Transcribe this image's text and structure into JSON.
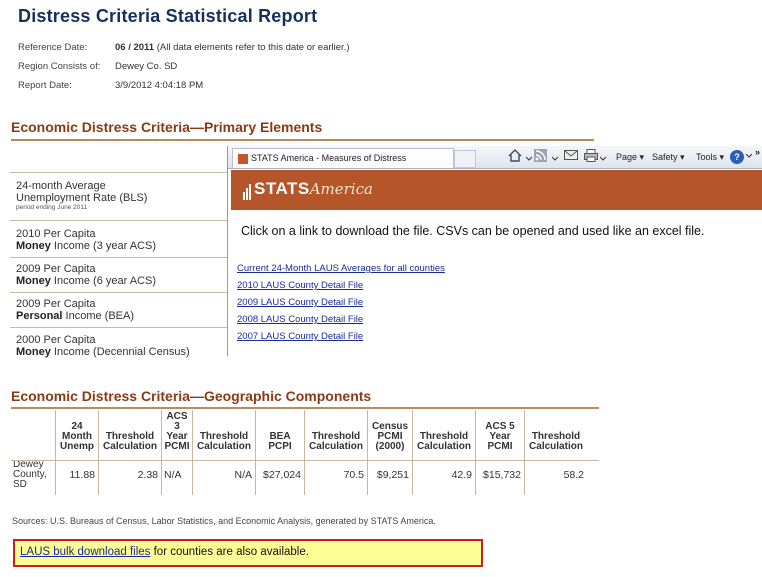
{
  "report": {
    "title": "Distress Criteria Statistical Report",
    "meta": [
      {
        "label": "Reference Date:",
        "value_bold": "06 / 2011",
        "value_rest": " (All data elements refer to this date or earlier.)"
      },
      {
        "label": "Region Consists of:",
        "value_bold": "",
        "value_rest": "Dewey Co. SD"
      },
      {
        "label": "Report Date:",
        "value_bold": "",
        "value_rest": "3/9/2012 4:04:18 PM"
      }
    ]
  },
  "primary": {
    "heading": "Economic Distress Criteria—Primary Elements",
    "items": [
      {
        "line1": "24-month Average",
        "line2": "Unemployment Rate (BLS)",
        "bold": "",
        "sub": "period ending June 2011"
      },
      {
        "line1": "2010 Per Capita",
        "bold": "Money",
        "line2": " Income (3 year ACS)",
        "sub": ""
      },
      {
        "line1": "2009 Per Capita",
        "bold": "Money",
        "line2": " Income (6 year ACS)",
        "sub": ""
      },
      {
        "line1": "2009 Per Capita",
        "bold": "Personal",
        "line2": " Income (BEA)",
        "sub": ""
      },
      {
        "line1": "2000 Per Capita",
        "bold": "Money",
        "line2": " Income (Decennial Census)",
        "sub": ""
      }
    ]
  },
  "browser": {
    "tab_title": "STATS America - Measures of Distress",
    "toolbar": {
      "page": "Page ▾",
      "safety": "Safety ▾",
      "tools": "Tools ▾",
      "help": "?",
      "chevrons": "»"
    },
    "logo_main": "STATS",
    "logo_script": "America",
    "instruction": "Click on a link to download the file. CSVs can be opened and used like an excel file.",
    "links": [
      "Current 24-Month LAUS Averages for all counties",
      "2010 LAUS County Detail File",
      "2009 LAUS County Detail File",
      "2008 LAUS County Detail File",
      "2007 LAUS County Detail File"
    ],
    "icons": [
      "home-icon",
      "rss-icon",
      "mail-icon",
      "print-icon",
      "help-icon"
    ]
  },
  "geographic": {
    "heading": "Economic Distress Criteria—Geographic Components",
    "columns": [
      [
        "",
        "",
        ""
      ],
      [
        "24",
        "Month",
        "Unemp"
      ],
      [
        "",
        "Threshold",
        "Calculation"
      ],
      [
        "ACS",
        "3",
        "Year",
        "PCMI"
      ],
      [
        "",
        "Threshold",
        "Calculation"
      ],
      [
        "",
        "BEA",
        "PCPI"
      ],
      [
        "",
        "Threshold",
        "Calculation"
      ],
      [
        "Census",
        "PCMI",
        "(2000)"
      ],
      [
        "",
        "Threshold",
        "Calculation"
      ],
      [
        "ACS 5",
        "Year",
        "PCMI"
      ],
      [
        "",
        "Threshold",
        "Calculation"
      ]
    ],
    "rows": [
      {
        "area": [
          "Dewey",
          "County,",
          "SD"
        ],
        "values": [
          "11.88",
          "2.38",
          "N/A",
          "N/A",
          "$27,024",
          "70.5",
          "$9,251",
          "42.9",
          "$15,732",
          "58.2"
        ]
      }
    ]
  },
  "source": "Sources: U.S. Bureaus of Census, Labor Statistics, and Economic Analysis, generated by STATS America.",
  "callout": {
    "link": "LAUS bulk download files",
    "rest": " for counties are also available."
  }
}
